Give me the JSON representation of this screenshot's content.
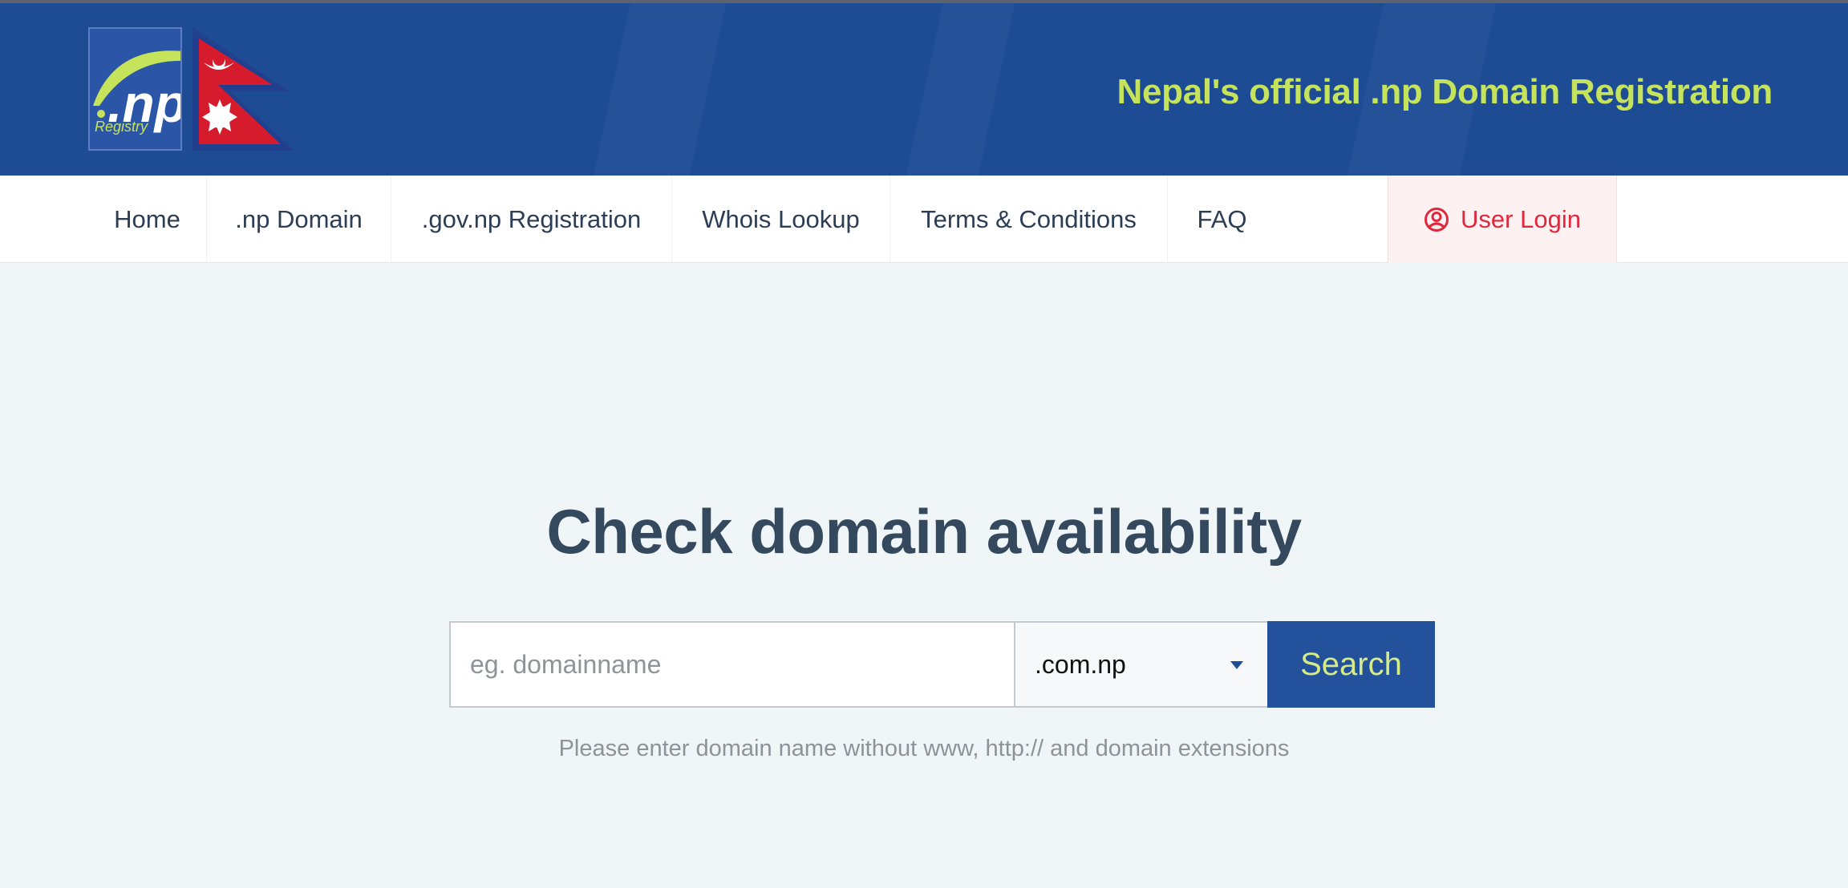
{
  "header": {
    "tagline": "Nepal's official .np Domain Registration",
    "logo_text": ".np",
    "logo_subtext": "Registry",
    "colors": {
      "background": "#1d4b94",
      "tagline": "#c6e35c"
    }
  },
  "nav": {
    "items": [
      {
        "label": "Home"
      },
      {
        "label": ".np Domain"
      },
      {
        "label": ".gov.np Registration"
      },
      {
        "label": "Whois Lookup"
      },
      {
        "label": "Terms & Conditions"
      },
      {
        "label": "FAQ"
      }
    ],
    "login": {
      "label": "User Login",
      "icon": "user-circle-icon",
      "color": "#e0283c"
    }
  },
  "main": {
    "headline": "Check domain availability",
    "search": {
      "placeholder": "eg. domainname",
      "value": "",
      "tld_selected": ".com.np",
      "button_label": "Search"
    },
    "hint": "Please enter domain name without www, http:// and domain extensions"
  }
}
